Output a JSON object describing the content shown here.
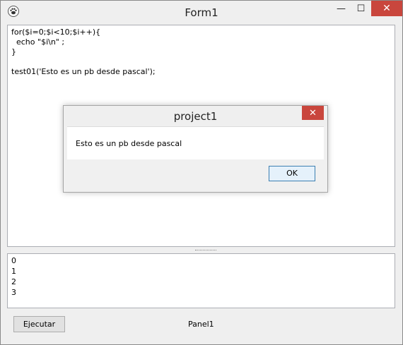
{
  "window": {
    "title": "Form1",
    "min_glyph": "—",
    "max_glyph": "☐",
    "close_glyph": "✕"
  },
  "editor": {
    "code": "for($i=0;$i<10;$i++){\n  echo \"$i\\n\" ;\n}\n\ntest01('Esto es un pb desde pascal');"
  },
  "output": {
    "lines": [
      "0",
      "1",
      "2",
      "3"
    ]
  },
  "panel": {
    "execute_label": "Ejecutar",
    "caption": "Panel1"
  },
  "dialog": {
    "title": "project1",
    "message": "Esto es un pb desde pascal",
    "ok_label": "OK",
    "close_glyph": "✕"
  },
  "colors": {
    "close_red": "#c9463d",
    "ok_border": "#3c7fb1"
  }
}
